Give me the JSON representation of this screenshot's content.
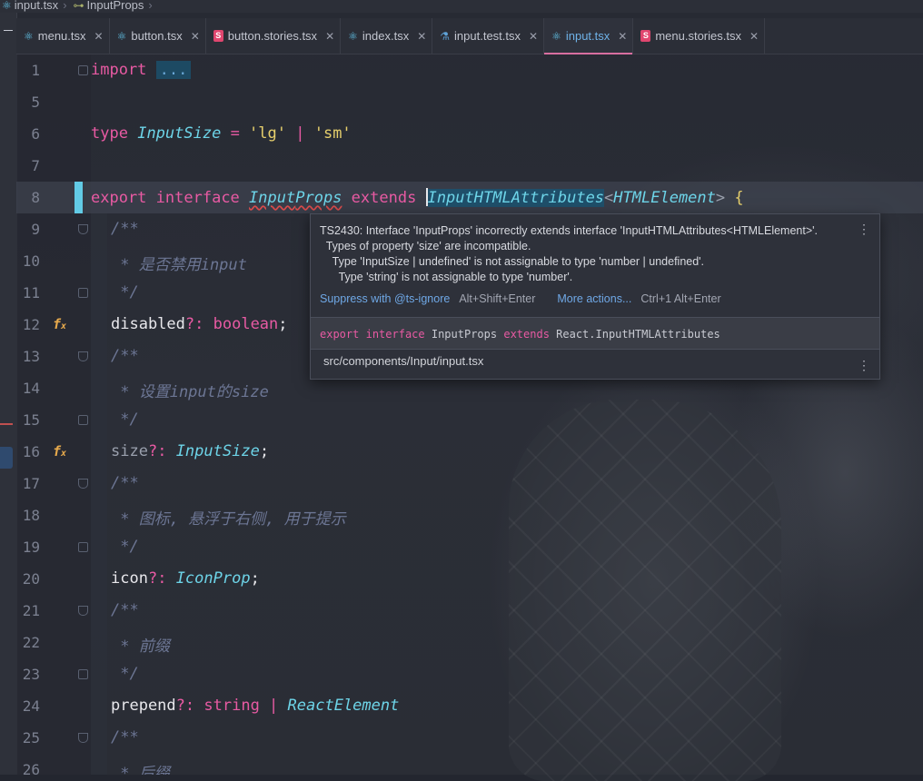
{
  "breadcrumb": {
    "file": "input.tsx",
    "symbol": "InputProps"
  },
  "tabs": [
    {
      "label": "menu.tsx",
      "icon": "react-icon"
    },
    {
      "label": "button.tsx",
      "icon": "react-icon"
    },
    {
      "label": "button.stories.tsx",
      "icon": "storybook-icon"
    },
    {
      "label": "index.tsx",
      "icon": "react-icon"
    },
    {
      "label": "input.test.tsx",
      "icon": "test-icon"
    },
    {
      "label": "input.tsx",
      "icon": "react-icon",
      "active": true
    },
    {
      "label": "menu.stories.tsx",
      "icon": "storybook-icon"
    }
  ],
  "colors": {
    "keyword": "#e85aa3",
    "type": "#6dd4e8",
    "string": "#e6cf6c",
    "comment": "#6c7694",
    "active_tab_underline": "#d86fa0"
  },
  "editor": {
    "lines": [
      {
        "n": "1",
        "t1": "import",
        "t2": "..."
      },
      {
        "n": "5"
      },
      {
        "n": "6",
        "t1": "type",
        "t2": "InputSize",
        "t3": " = ",
        "t4": "'lg'",
        "t5": " | ",
        "t6": "'sm'"
      },
      {
        "n": "7"
      },
      {
        "n": "8",
        "t1": "export",
        "t2": "interface",
        "t3": "Input",
        "t4": "Props",
        "t5": "extends",
        "t6": "InputHTMLAttributes",
        "t7": "<",
        "t8": "HTMLElement",
        "t9": ">",
        "t10": "{"
      },
      {
        "n": "9",
        "t1": "/**"
      },
      {
        "n": "10",
        "t1": " * 是否禁用input"
      },
      {
        "n": "11",
        "t1": " */"
      },
      {
        "n": "12",
        "t1": "disabled",
        "t2": "?:",
        "t3": "boolean",
        "t4": ";"
      },
      {
        "n": "13",
        "t1": "/**"
      },
      {
        "n": "14",
        "t1": " * 设置input的size"
      },
      {
        "n": "15",
        "t1": " */"
      },
      {
        "n": "16",
        "t1": "size",
        "t2": "?:",
        "t3": "InputSize",
        "t4": ";"
      },
      {
        "n": "17",
        "t1": "/**"
      },
      {
        "n": "18",
        "t1": " * 图标, 悬浮于右侧, 用于提示"
      },
      {
        "n": "19",
        "t1": " */"
      },
      {
        "n": "20",
        "t1": "icon",
        "t2": "?:",
        "t3": "IconProp",
        "t4": ";"
      },
      {
        "n": "21",
        "t1": "/**"
      },
      {
        "n": "22",
        "t1": " * 前缀"
      },
      {
        "n": "23",
        "t1": " */"
      },
      {
        "n": "24",
        "t1": "prepend",
        "t2": "?:",
        "t3": "string",
        "t4": " | ",
        "t5": "ReactElement"
      },
      {
        "n": "25",
        "t1": "/**"
      },
      {
        "n": "26",
        "t1": " * 后缀"
      }
    ]
  },
  "tooltip": {
    "error_lines": [
      "TS2430: Interface 'InputProps' incorrectly extends interface 'InputHTMLAttributes<HTMLElement>'.",
      "  Types of property 'size' are incompatible.",
      "    Type 'InputSize | undefined' is not assignable to type 'number | undefined'.",
      "      Type 'string' is not assignable to type 'number'."
    ],
    "suppress_label": "Suppress with @ts-ignore",
    "suppress_shortcut": "Alt+Shift+Enter",
    "more_label": "More actions...",
    "more_shortcut": "Ctrl+1 Alt+Enter",
    "decl": {
      "k1": "export",
      "k2": "interface",
      "name": "InputProps",
      "k3": "extends",
      "base": "React.InputHTMLAttributes"
    },
    "path": "src/components/Input/input.tsx",
    "menu_icon": "more-vertical-icon"
  }
}
